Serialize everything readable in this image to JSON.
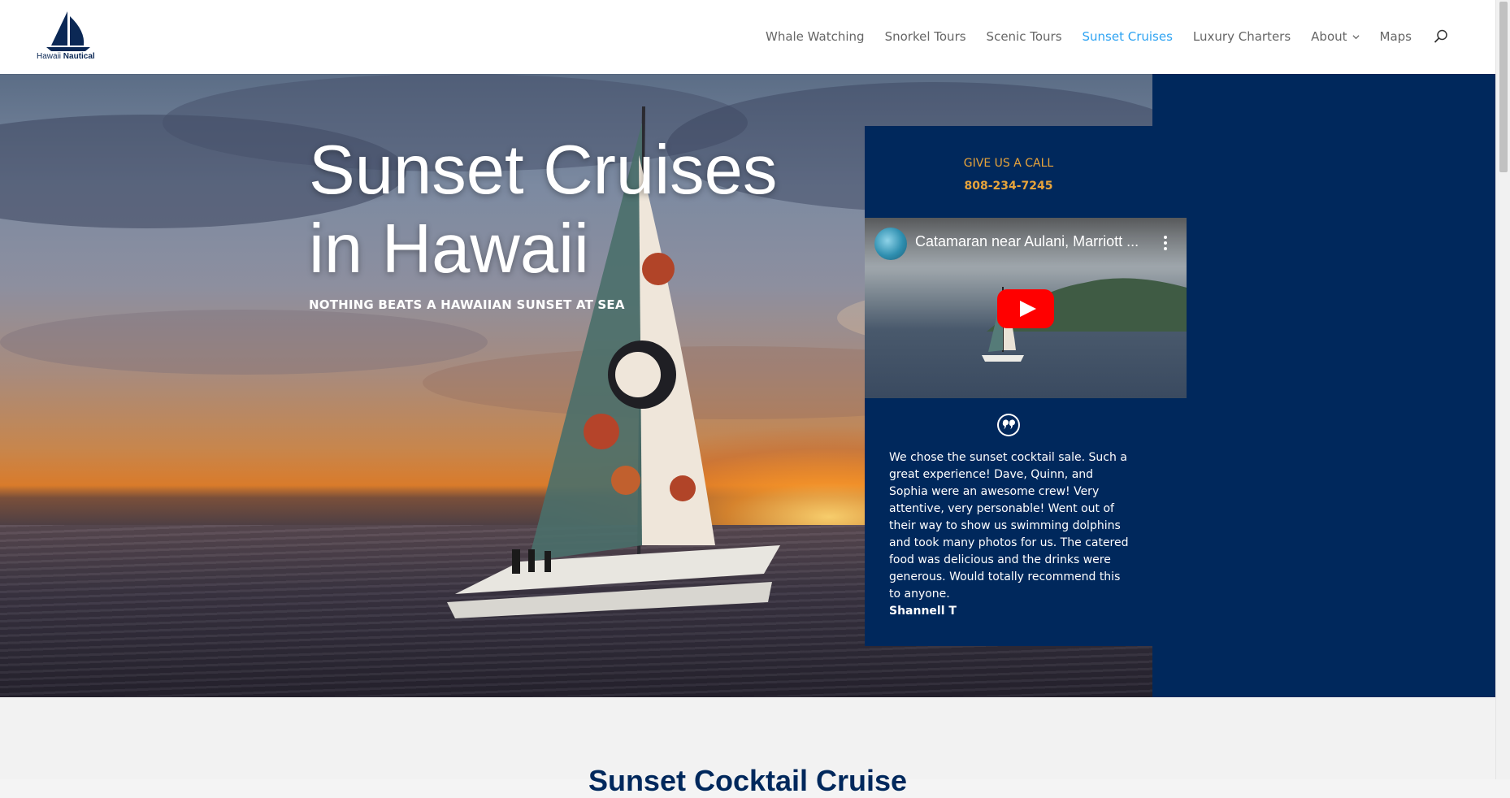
{
  "header": {
    "logo_text_regular": "Hawaii",
    "logo_text_bold": "Nautical",
    "nav": [
      {
        "label": "Whale Watching"
      },
      {
        "label": "Snorkel Tours"
      },
      {
        "label": "Scenic Tours"
      },
      {
        "label": "Sunset Cruises",
        "active": true
      },
      {
        "label": "Luxury Charters"
      },
      {
        "label": "About",
        "has_dropdown": true
      },
      {
        "label": "Maps"
      }
    ],
    "search_icon": "search-icon"
  },
  "hero": {
    "title": "Sunset Cruises in Hawaii",
    "subtitle": "NOTHING BEATS A HAWAIIAN SUNSET AT SEA"
  },
  "panel": {
    "call_label": "GIVE US A CALL",
    "phone": "808-234-7245",
    "video": {
      "title": "Catamaran near Aulani, Marriott ...",
      "play_icon": "play-icon",
      "menu_icon": "more-vert-icon"
    },
    "quote_icon": "quote-icon",
    "testimonial": "We chose the sunset cocktail sale. Such a great experience! Dave, Quinn, and Sophia were an awesome crew! Very attentive, very personable! Went out of their way to show us swimming dolphins and took many photos for us. The catered food was delicious and the drinks were generous. Would totally recommend this to anyone.",
    "author": "Shannell T"
  },
  "below": {
    "section_title": "Sunset Cocktail Cruise"
  },
  "colors": {
    "navy": "#00285c",
    "accent_orange": "#e8a43a",
    "nav_active": "#2ea3f2",
    "nav_text": "#666666"
  }
}
